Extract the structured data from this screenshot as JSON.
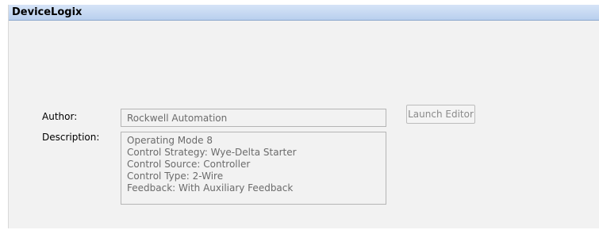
{
  "window": {
    "title": "DeviceLogix"
  },
  "form": {
    "author_label": "Author:",
    "author_value": "Rockwell Automation",
    "description_label": "Description:",
    "description_lines": [
      "Operating Mode 8",
      "Control Strategy:  Wye-Delta Starter",
      "Control Source:  Controller",
      "Control Type:  2-Wire",
      "Feedback:  With Auxiliary Feedback"
    ]
  },
  "buttons": {
    "launch_editor_label": "Launch Editor"
  },
  "colors": {
    "titlebar_bg": "#c6d9f3",
    "panel_bg": "#f2f2f2",
    "disabled_text": "#6b6b6b"
  }
}
